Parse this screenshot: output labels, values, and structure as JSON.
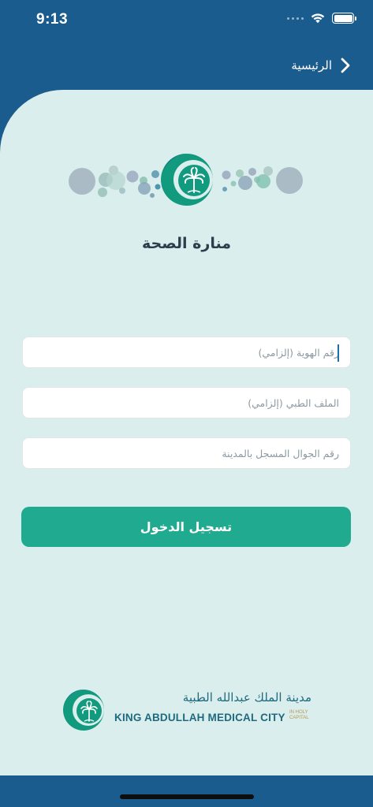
{
  "status_bar": {
    "time": "9:13"
  },
  "nav": {
    "back_label": "الرئيسية"
  },
  "app": {
    "title": "منارة الصحة"
  },
  "form": {
    "id_placeholder": "رقم الهوية (إلزامي)",
    "file_placeholder": "الملف الطبي (إلزامي)",
    "phone_placeholder": "رقم الجوال المسجل بالمدينة",
    "login_label": "تسجيل الدخول"
  },
  "footer": {
    "name_ar": "مدينة الملك عبدالله الطبية",
    "name_en": "KING ABDULLAH MEDICAL CITY",
    "sub_en": "IN HOLY CAPITAL"
  },
  "colors": {
    "header_blue": "#1b5c8e",
    "background": "#dbeeee",
    "primary_green": "#20aa8f",
    "logo_teal": "#129a7e"
  }
}
